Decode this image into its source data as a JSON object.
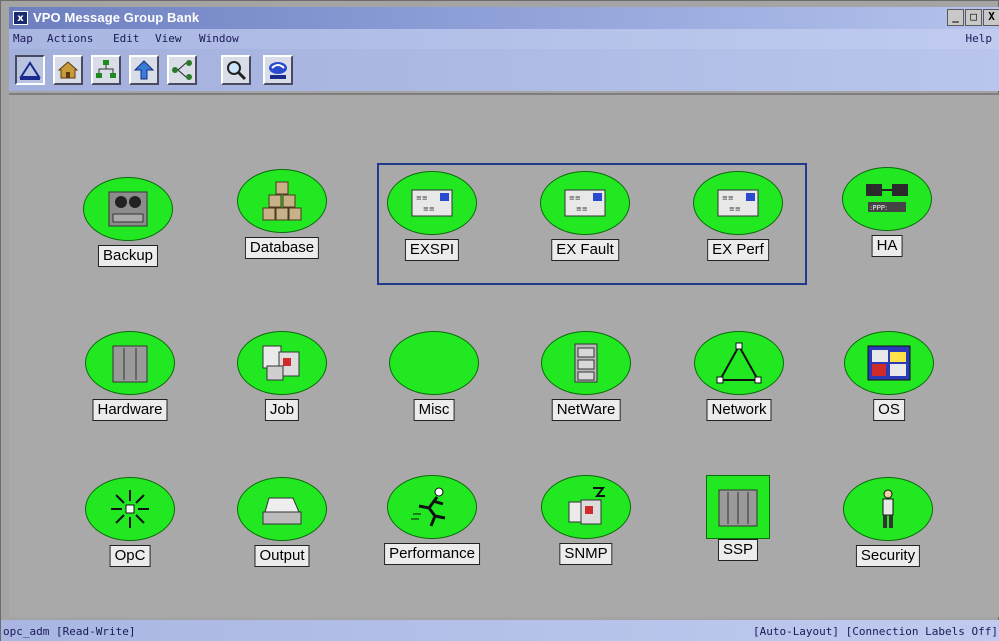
{
  "window": {
    "title": "VPO Message Group Bank",
    "app_icon_letter": "x",
    "controls": {
      "minimize": "_",
      "restore": "□",
      "close": "X"
    }
  },
  "menu": {
    "map": "Map",
    "actions": "Actions",
    "edit": "Edit",
    "view": "View",
    "window": "Window",
    "help": "Help"
  },
  "toolbar": {
    "buttons": [
      "map-view-icon",
      "home-icon",
      "tree-icon",
      "up-arrow-icon",
      "network-icon",
      "magnifier-icon",
      "ovw-icon"
    ]
  },
  "nodes": [
    {
      "label": "Backup",
      "icon": "tape-drive-icon"
    },
    {
      "label": "Database",
      "icon": "database-icon"
    },
    {
      "label": "EXSPI",
      "icon": "exchange-icon"
    },
    {
      "label": "EX Fault",
      "icon": "exchange-icon"
    },
    {
      "label": "EX Perf",
      "icon": "exchange-icon"
    },
    {
      "label": "HA",
      "icon": "ha-cluster-icon"
    },
    {
      "label": "Hardware",
      "icon": "hardware-icon"
    },
    {
      "label": "Job",
      "icon": "job-icon"
    },
    {
      "label": "Misc",
      "icon": "none"
    },
    {
      "label": "NetWare",
      "icon": "file-cabinet-icon"
    },
    {
      "label": "Network",
      "icon": "network-triangle-icon"
    },
    {
      "label": "OS",
      "icon": "os-windows-icon"
    },
    {
      "label": "OpC",
      "icon": "opc-burst-icon"
    },
    {
      "label": "Output",
      "icon": "printer-icon"
    },
    {
      "label": "Performance",
      "icon": "runner-icon"
    },
    {
      "label": "SNMP",
      "icon": "snmp-icon"
    },
    {
      "label": "SSP",
      "icon": "ssp-cabinet-icon"
    },
    {
      "label": "Security",
      "icon": "guard-icon"
    }
  ],
  "status": {
    "left": "opc_adm [Read-Write]",
    "right": "[Auto-Layout] [Connection Labels Off]"
  },
  "colors": {
    "node_fill": "#22e822",
    "group_border": "#1f3c8a",
    "titlebar": "#6e7fc0"
  }
}
